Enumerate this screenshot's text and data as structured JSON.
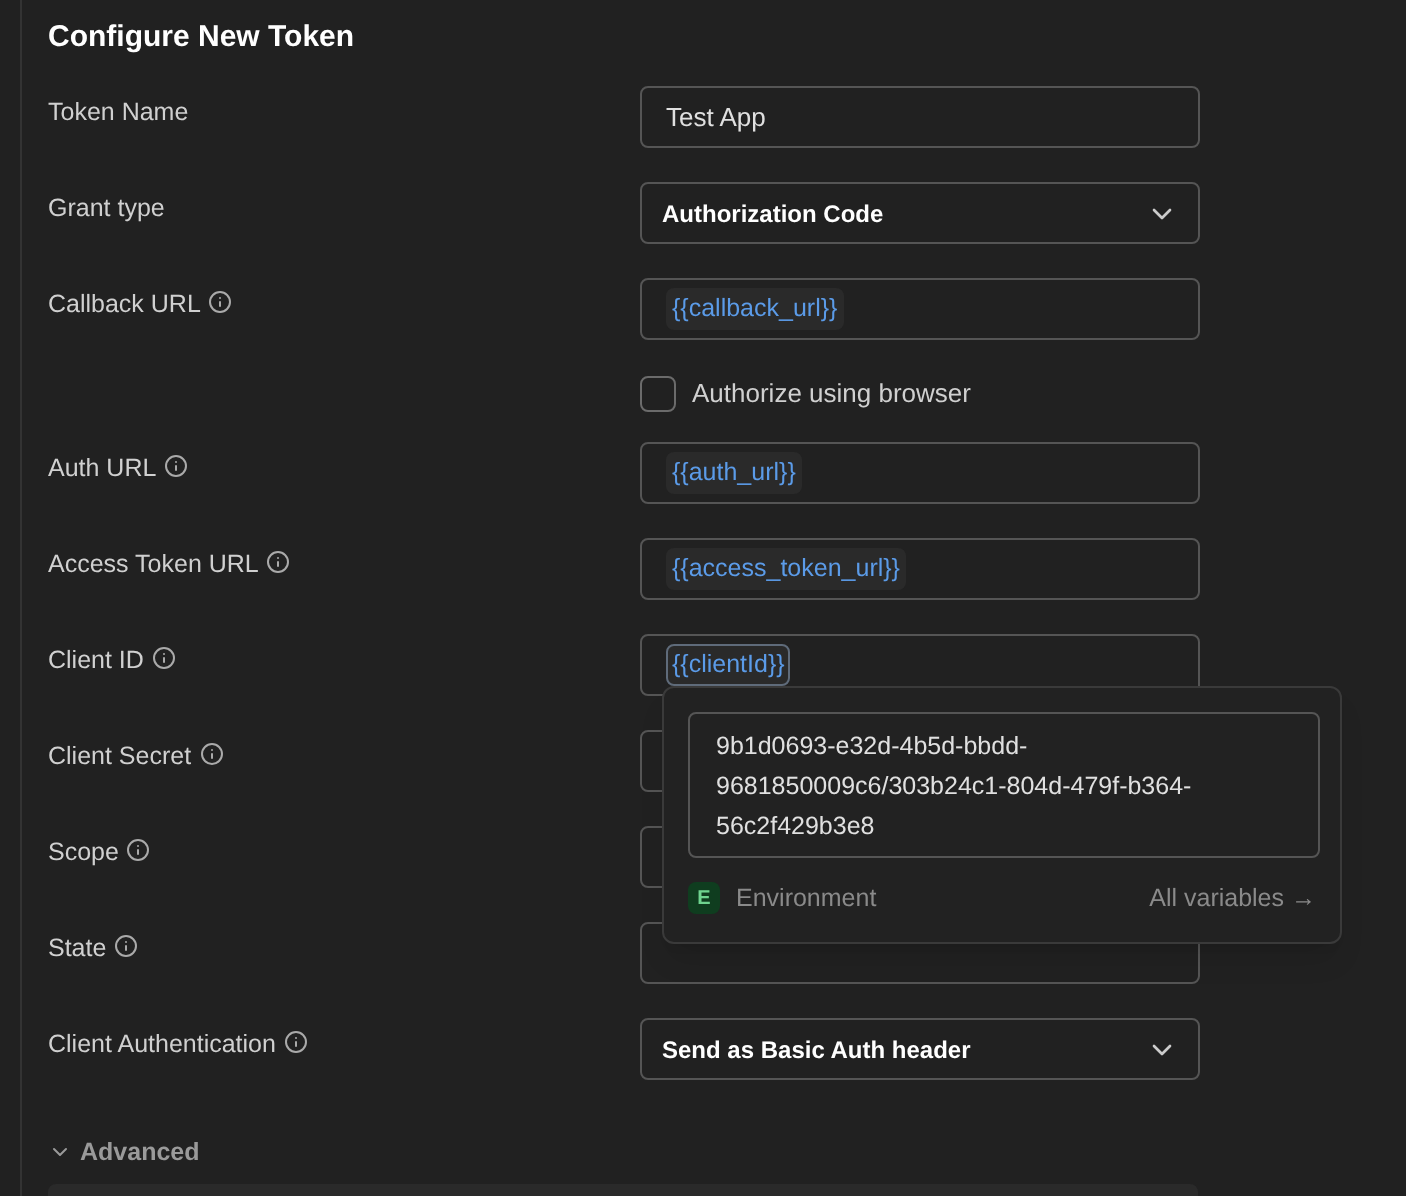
{
  "title": "Configure New Token",
  "fields": [
    {
      "label": "Token Name",
      "info": false,
      "kind": "text",
      "value": "Test App"
    },
    {
      "label": "Grant type",
      "info": false,
      "kind": "select",
      "value": "Authorization Code"
    },
    {
      "label": "Callback URL",
      "info": true,
      "kind": "variable",
      "value": "{{callback_url}}",
      "focused": false
    },
    {
      "kind": "checkbox",
      "label": "Authorize using browser",
      "checked": false
    },
    {
      "label": "Auth URL",
      "info": true,
      "kind": "variable",
      "value": "{{auth_url}}",
      "focused": false
    },
    {
      "label": "Access Token URL",
      "info": true,
      "kind": "variable",
      "value": "{{access_token_url}}",
      "focused": false
    },
    {
      "label": "Client ID",
      "info": true,
      "kind": "variable",
      "value": "{{clientId}}",
      "focused": true
    },
    {
      "label": "Client Secret",
      "info": true,
      "kind": "text"
    },
    {
      "label": "Scope",
      "info": true,
      "kind": "text"
    },
    {
      "label": "State",
      "info": true,
      "kind": "text"
    },
    {
      "label": "Client Authentication",
      "info": true,
      "kind": "select",
      "value": "Send as Basic Auth header"
    }
  ],
  "popover": {
    "value": "9b1d0693-e32d-4b5d-bbdd-9681850009c6/303b24c1-804d-479f-b364-56c2f429b3e8",
    "scope_badge": "E",
    "scope": "Environment",
    "link": "All variables →"
  },
  "advanced": {
    "label": "Advanced",
    "expanded": true
  }
}
